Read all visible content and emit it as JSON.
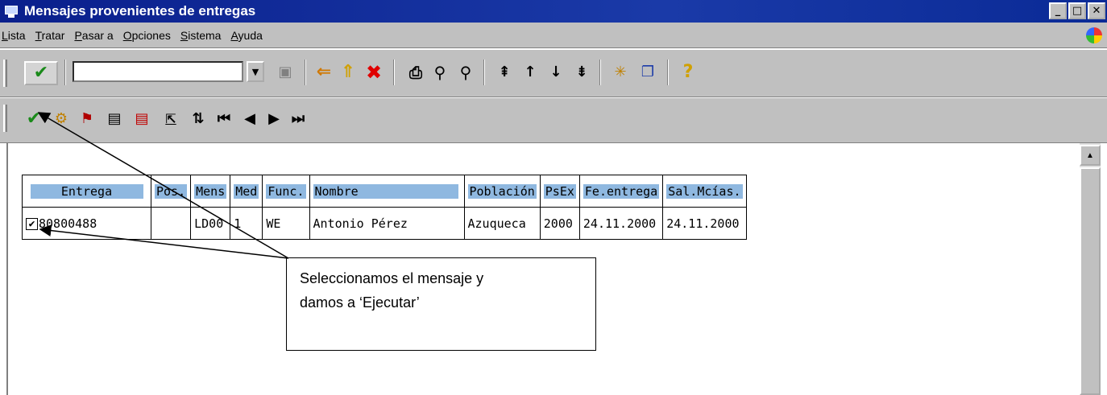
{
  "window": {
    "title": "Mensajes provenientes de entregas",
    "buttons": [
      "_",
      "□",
      "✕"
    ]
  },
  "menubar": {
    "items": [
      {
        "accel": "L",
        "rest": "ista"
      },
      {
        "accel": "T",
        "rest": "ratar"
      },
      {
        "accel": "P",
        "rest": "asar a"
      },
      {
        "accel": "O",
        "rest": "pciones"
      },
      {
        "accel": "S",
        "rest": "istema"
      },
      {
        "accel": "A",
        "rest": "yuda"
      }
    ]
  },
  "toolbar1": {
    "command_field_value": "",
    "icons": [
      "enter-icon",
      "save-icon",
      "back-icon",
      "exit-icon",
      "cancel-icon",
      "print-icon",
      "find-icon",
      "find-next-icon",
      "first-page-icon",
      "previous-page-icon",
      "next-page-icon",
      "last-page-icon",
      "create-session-icon",
      "shortcut-icon",
      "help-icon"
    ]
  },
  "toolbar2": {
    "icons": [
      "execute-icon",
      "display-icon",
      "filter-icon",
      "select-all-icon",
      "deselect-all-icon",
      "select-block-icon",
      "sort-icon",
      "first-record-icon",
      "previous-record-icon",
      "next-record-icon",
      "last-record-icon"
    ]
  },
  "table": {
    "columns": [
      "Entrega",
      "Pos.",
      "Mens",
      "Med",
      "Func.",
      "Nombre",
      "Población",
      "PsEx",
      "Fe.entrega",
      "Sal.Mcías."
    ],
    "rows": [
      {
        "checked": true,
        "entrega": "80800488",
        "pos": "",
        "mens": "LD00",
        "med": "1",
        "func": "WE",
        "nombre": "Antonio Pérez",
        "poblacion": "Azuqueca",
        "psex": "2000",
        "fe_entrega": "24.11.2000",
        "sal_mcias": "24.11.2000"
      }
    ]
  },
  "callout": {
    "line1": "Seleccionamos el mensaje y",
    "line2": "damos a ‘Ejecutar’"
  },
  "colors": {
    "titlebar": "#0a1f8c",
    "chrome": "#c0c0c0",
    "header_highlight": "#8fb8e0"
  }
}
